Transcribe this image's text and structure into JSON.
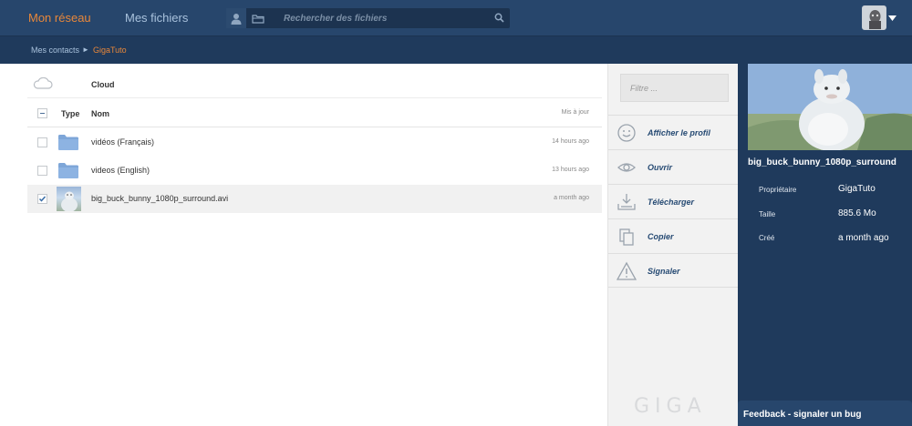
{
  "nav": {
    "reseau": "Mon réseau",
    "fichiers": "Mes fichiers"
  },
  "search": {
    "placeholder": "Rechercher des fichiers"
  },
  "breadcrumb": {
    "parent": "Mes contacts",
    "separator": "►",
    "current": "GigaTuto"
  },
  "filelist": {
    "cloud_label": "Cloud",
    "headers": {
      "type": "Type",
      "nom": "Nom",
      "maj": "Mis à jour"
    },
    "rows": [
      {
        "name": "vidéos (Français)",
        "date": "14 hours ago",
        "kind": "folder"
      },
      {
        "name": "videos (English)",
        "date": "13 hours ago",
        "kind": "folder"
      },
      {
        "name": "big_buck_bunny_1080p_surround.avi",
        "date": "a month ago",
        "kind": "video"
      }
    ]
  },
  "actions": {
    "filter_placeholder": "Filtre ...",
    "items": [
      {
        "label": "Afficher le profil",
        "icon": "smiley-icon"
      },
      {
        "label": "Ouvrir",
        "icon": "eye-icon"
      },
      {
        "label": "Télécharger",
        "icon": "download-icon"
      },
      {
        "label": "Copier",
        "icon": "copy-icon"
      },
      {
        "label": "Signaler",
        "icon": "warning-icon"
      }
    ],
    "logo": "GIGA"
  },
  "details": {
    "title": "big_buck_bunny_1080p_surround",
    "meta": [
      {
        "key": "Propriétaire",
        "value": "GigaTuto"
      },
      {
        "key": "Taille",
        "value": "885.6 Mo"
      },
      {
        "key": "Créé",
        "value": "a month ago"
      }
    ]
  },
  "feedback": {
    "label": "Feedback - signaler un bug"
  },
  "colors": {
    "topbar": "#27466c",
    "accent": "#e8873a",
    "nav_link": "#a9c2dd",
    "action_text": "#264a73",
    "detail_panel": "#1f3a5c"
  }
}
